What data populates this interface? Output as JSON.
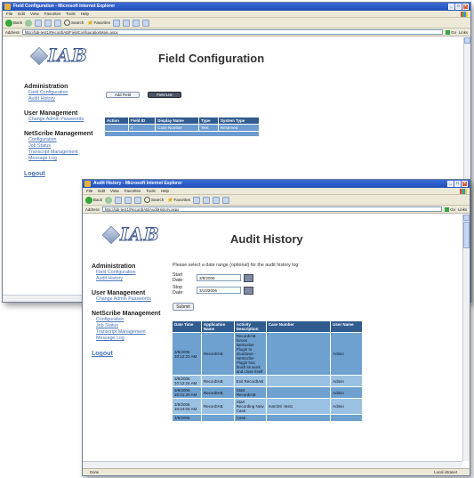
{
  "browser": {
    "menu": [
      "File",
      "Edit",
      "View",
      "Favorites",
      "Tools",
      "Help"
    ],
    "toolbar": {
      "back": "Back",
      "search": "Search",
      "favorites": "Favorites"
    },
    "address_label": "Address",
    "go_label": "Go",
    "links_label": "Links"
  },
  "window1": {
    "title": "Field Configuration - Microsoft Internet Explorer",
    "address": "http://lab-test1/RecordIAB/FieldConfigurationMain.aspx",
    "logo": "IAB",
    "page_title": "Field Configuration",
    "tabs": [
      "Add Field",
      "Field List"
    ],
    "sidebar": {
      "admin_heading": "Administration",
      "admin_links": [
        "Field Configuration",
        "Audit History"
      ],
      "user_heading": "User Management",
      "user_links": [
        "Change Admin Passwords"
      ],
      "scribe_heading": "NetScribe Management",
      "scribe_links": [
        "Configuration",
        "Job Status",
        "Transcript Management",
        "Message Log"
      ],
      "logout": "Logout"
    },
    "table": {
      "headers": [
        "Action",
        "Field ID",
        "Display Name",
        "Type",
        "System Type"
      ],
      "rows": [
        [
          "",
          "1",
          "Case Number",
          "Text",
          "Reserved"
        ]
      ]
    }
  },
  "window2": {
    "title": "Audit History - Microsoft Internet Explorer",
    "address": "http://lab-test1/RecordIAB/AuditHistory.aspx",
    "logo": "IAB",
    "page_title": "Audit History",
    "prompt": "Please select a date range (optional) for the audit history log:",
    "start_label": "Start Date:",
    "start_value": "3/8/2006",
    "stop_label": "Stop Date:",
    "stop_value": "3/10/2006",
    "submit": "Submit",
    "sidebar": {
      "admin_heading": "Administration",
      "admin_links": [
        "Field Configuration",
        "Audit History"
      ],
      "user_heading": "User Management",
      "user_links": [
        "Change Admin Passwords"
      ],
      "scribe_heading": "NetScribe Management",
      "scribe_links": [
        "Configuration",
        "Job Status",
        "Transcript Management",
        "Message Log"
      ],
      "logout": "Logout"
    },
    "table": {
      "headers": [
        "Date Time",
        "Application Name",
        "Activity Description",
        "Case Number",
        "User Name"
      ],
      "rows": [
        [
          "3/9/2006 10:12:23 AM",
          "RecordIAB",
          "RecordIAB forces NetScribe Plugin to shutdown - NetScribe Plugin has finish its work and close itself",
          "",
          "Admin"
        ],
        [
          "3/9/2006 10:12:24 AM",
          "RecordIAB",
          "Exit RecordIAB",
          "",
          "Admin"
        ],
        [
          "3/9/2006 10:21:20 AM",
          "RecordIAB",
          "Start RecordIAB",
          "",
          "Admin"
        ],
        [
          "3/9/2006 10:24:03 AM",
          "RecordIAB",
          "Start Recording New Case",
          "march9 -test1",
          "Admin"
        ],
        [
          "3/9/2006",
          "",
          "Case",
          "",
          ""
        ]
      ]
    },
    "status_left": "Done",
    "status_zone": "Local intranet"
  },
  "colors": {
    "header_blue": "#315c90",
    "row_blue": "#6ea1cf",
    "row_light": "#9bc1e2",
    "link": "#4a74b8",
    "xp_title": "#2a5bc8"
  }
}
